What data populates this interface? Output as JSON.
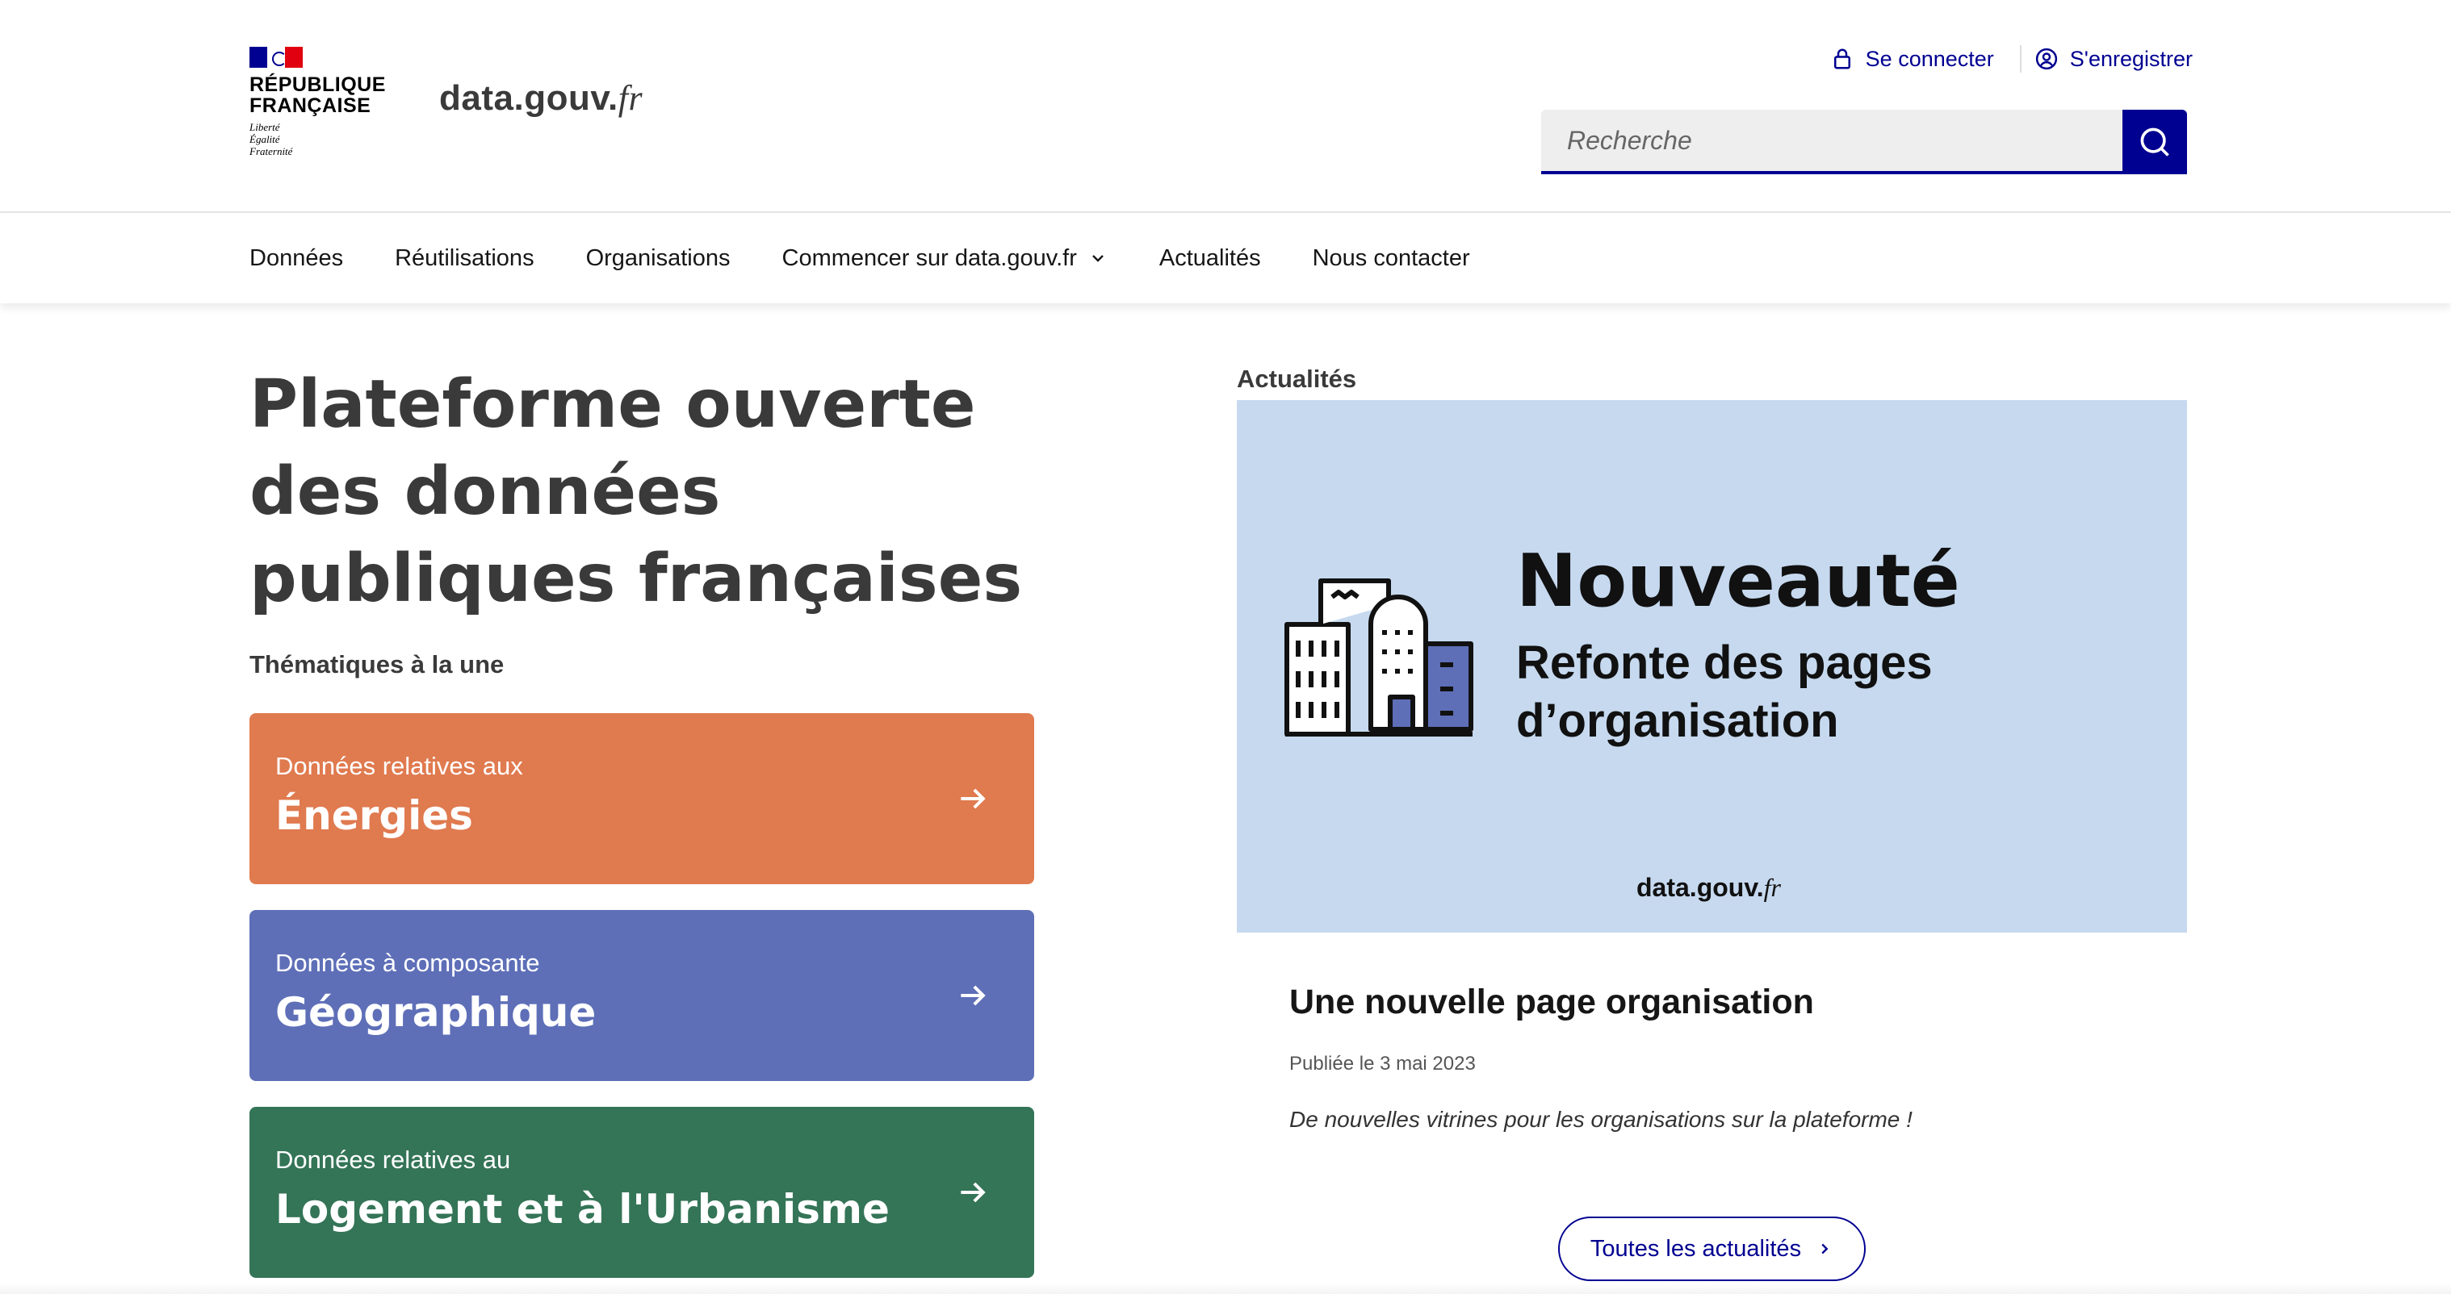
{
  "header": {
    "rf_name": [
      "RÉPUBLIQUE",
      "FRANÇAISE"
    ],
    "rf_motto": [
      "Liberté",
      "Égalité",
      "Fraternité"
    ],
    "site_logo_main": "data.gouv.",
    "site_logo_fr": "fr",
    "login_label": "Se connecter",
    "register_label": "S'enregistrer",
    "search_placeholder": "Recherche",
    "icons": [
      "lock-icon",
      "user-circle-icon",
      "search-icon"
    ]
  },
  "nav": {
    "items": [
      {
        "label": "Données"
      },
      {
        "label": "Réutilisations"
      },
      {
        "label": "Organisations"
      },
      {
        "label": "Commencer sur data.gouv.fr",
        "has_dropdown": true
      },
      {
        "label": "Actualités"
      },
      {
        "label": "Nous contacter"
      }
    ]
  },
  "hero": {
    "title": "Plateforme ouverte des données publiques françaises",
    "themes_label": "Thématiques à la une",
    "cards": [
      {
        "sub": "Données relatives aux",
        "main": "Énergies",
        "color": "#e07a4f"
      },
      {
        "sub": "Données à composante",
        "main": "Géographique",
        "color": "#5e6fb8"
      },
      {
        "sub": "Données relatives au",
        "main": "Logement et à l'Urbanisme",
        "color": "#347457"
      }
    ]
  },
  "news": {
    "label": "Actualités",
    "image": {
      "title": "Nouveauté",
      "subtitle_line1": "Refonte des pages",
      "subtitle_line2": "d’organisation",
      "logo_main": "data.gouv.",
      "logo_fr": "fr",
      "background": "#c6d9ef"
    },
    "article_title": "Une nouvelle page organisation",
    "article_date": "Publiée le 3 mai 2023",
    "article_desc": "De nouvelles vitrines pour les organisations sur la plateforme !",
    "all_news_label": "Toutes les actualités"
  },
  "colors": {
    "primary": "#000091",
    "text": "#161616"
  }
}
